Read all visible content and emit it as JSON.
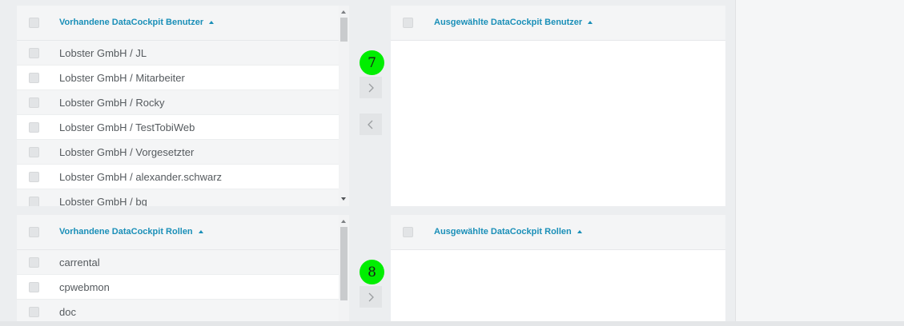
{
  "users": {
    "available_header": "Vorhandene DataCockpit Benutzer",
    "selected_header": "Ausgewählte DataCockpit Benutzer",
    "items": [
      "Lobster GmbH / JL",
      "Lobster GmbH / Mitarbeiter",
      "Lobster GmbH / Rocky",
      "Lobster GmbH / TestTobiWeb",
      "Lobster GmbH / Vorgesetzter",
      "Lobster GmbH / alexander.schwarz",
      "Lobster GmbH / bg"
    ],
    "badge": "7"
  },
  "roles": {
    "available_header": "Vorhandene DataCockpit Rollen",
    "selected_header": "Ausgewählte DataCockpit Rollen",
    "items": [
      "carrental",
      "cpwebmon",
      "doc"
    ],
    "badge": "8"
  },
  "icons": {
    "add": "chevron-right-icon",
    "remove": "chevron-left-icon",
    "sort": "sort-ascending-icon"
  },
  "colors": {
    "accent": "#1a8fb8",
    "badge": "#00ee00"
  }
}
